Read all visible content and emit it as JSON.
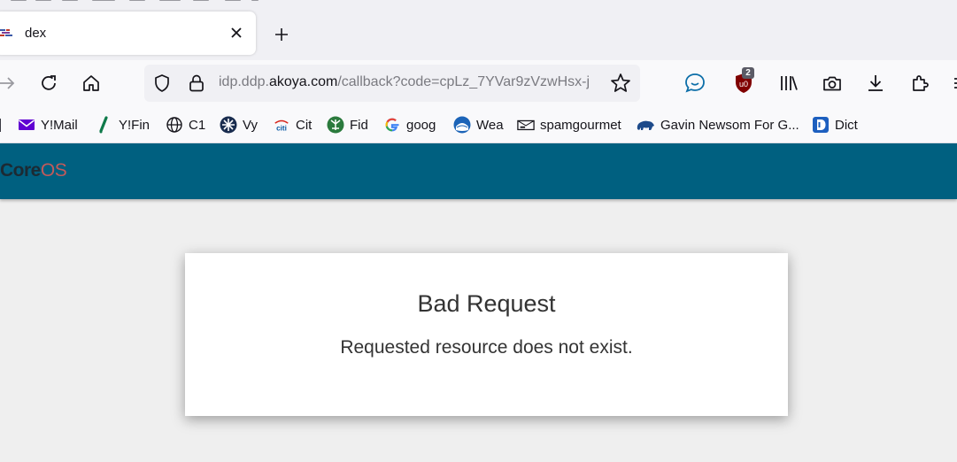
{
  "browser": {
    "tab": {
      "title": "dex"
    },
    "urlbar": {
      "prefix": "idp.ddp.",
      "domain": "akoya.com",
      "path": "/callback?code=cpLz_7YVar9zVzwHsx-j"
    },
    "extensions": {
      "ublock_badge": "2"
    }
  },
  "bookmarks": [
    {
      "label": "Y!Mail",
      "icon": "ymail-icon"
    },
    {
      "label": "Y!Fin",
      "icon": "yfin-icon"
    },
    {
      "label": "C1",
      "icon": "globe-icon"
    },
    {
      "label": "Vy",
      "icon": "vanguard-icon"
    },
    {
      "label": "Cit",
      "icon": "citi-icon"
    },
    {
      "label": "Fid",
      "icon": "fidelity-icon"
    },
    {
      "label": "goog",
      "icon": "google-icon"
    },
    {
      "label": "Wea",
      "icon": "noaa-icon"
    },
    {
      "label": "spamgourmet",
      "icon": "spamgourmet-icon"
    },
    {
      "label": "Gavin Newsom For G...",
      "icon": "bear-icon"
    },
    {
      "label": "Dict",
      "icon": "dictionary-icon"
    }
  ],
  "page": {
    "logo": {
      "core": "Core",
      "os": "OS"
    },
    "error": {
      "title": "Bad Request",
      "message": "Requested resource does not exist."
    }
  },
  "colors": {
    "header": "#006080",
    "card": "#ffffff",
    "background": "#efefef"
  }
}
